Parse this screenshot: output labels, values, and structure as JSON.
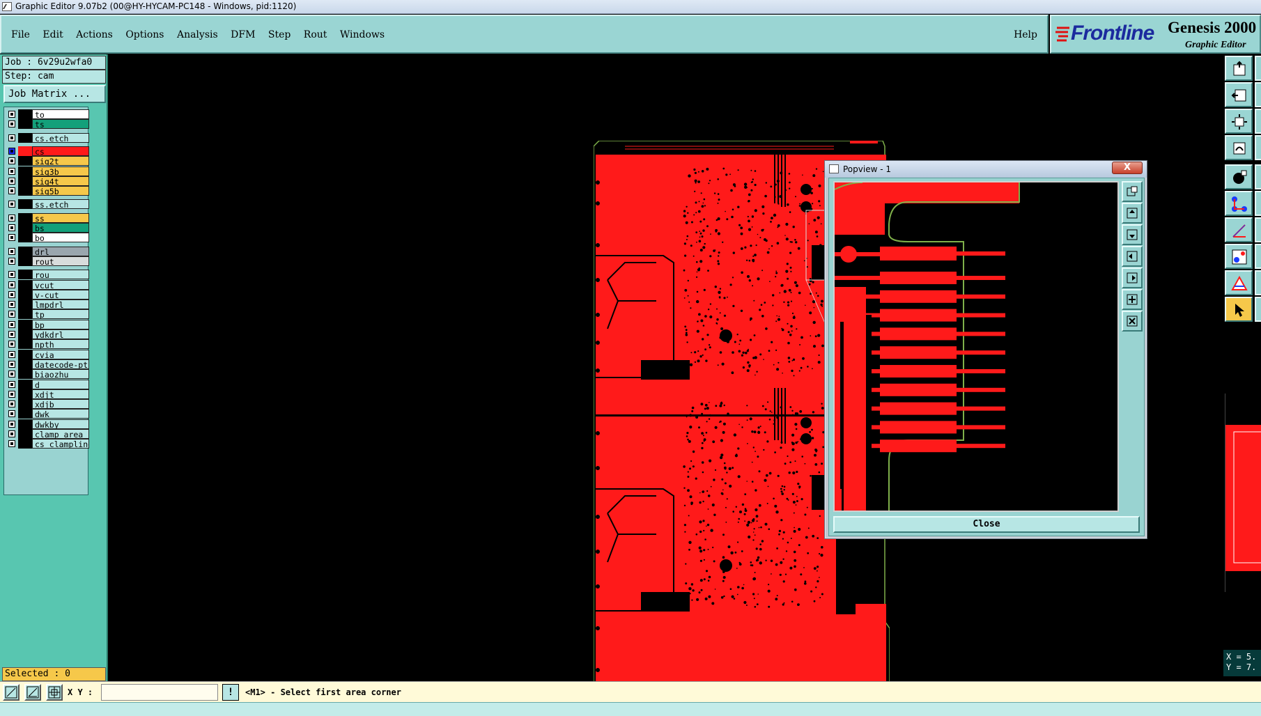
{
  "window": {
    "title": "Graphic Editor 9.07b2 (00@HY-HYCAM-PC148 - Windows, pid:1120)"
  },
  "menu": {
    "items": [
      "File",
      "Edit",
      "Actions",
      "Options",
      "Analysis",
      "DFM",
      "Step",
      "Rout",
      "Windows"
    ],
    "help": "Help"
  },
  "brand": {
    "logo": "Frontline",
    "product": "Genesis 2000",
    "subtitle": "Graphic Editor"
  },
  "job": {
    "job_label": "Job : 6v29u2wfa0",
    "step_label": "Step: cam",
    "matrix_button": "Job Matrix ..."
  },
  "layers": [
    {
      "name": "to",
      "color": "#ffffff",
      "group": 0
    },
    {
      "name": "ts",
      "color": "#13a07a",
      "group": 0
    },
    {
      "name": "cs.etch",
      "color": "#b7e6e4",
      "group": 1
    },
    {
      "name": "cs",
      "color": "#ff1a1a",
      "group": 2,
      "active": true
    },
    {
      "name": "sig2t",
      "color": "#f6c84a",
      "group": 2
    },
    {
      "name": "sig3b",
      "color": "#f6c84a",
      "group": 2
    },
    {
      "name": "sig4t",
      "color": "#f6c84a",
      "group": 2
    },
    {
      "name": "sig5b",
      "color": "#f6c84a",
      "group": 2
    },
    {
      "name": "ss.etch",
      "color": "#b7e6e4",
      "group": 3
    },
    {
      "name": "ss",
      "color": "#f6c84a",
      "group": 4
    },
    {
      "name": "bs",
      "color": "#13a07a",
      "group": 4
    },
    {
      "name": "bo",
      "color": "#ffffff",
      "group": 4
    },
    {
      "name": "drl",
      "color": "#9aa6ae",
      "group": 5
    },
    {
      "name": "rout",
      "color": "#d8dcdc",
      "group": 5
    },
    {
      "name": "rou",
      "color": "#b7e6e4",
      "group": 6
    },
    {
      "name": "vcut",
      "color": "#b7e6e4",
      "group": 6
    },
    {
      "name": "v-cut",
      "color": "#b7e6e4",
      "group": 6
    },
    {
      "name": "lmpdrl",
      "color": "#b7e6e4",
      "group": 6
    },
    {
      "name": "tp",
      "color": "#b7e6e4",
      "group": 6
    },
    {
      "name": "bp",
      "color": "#b7e6e4",
      "group": 6
    },
    {
      "name": "ydkdrl",
      "color": "#b7e6e4",
      "group": 6
    },
    {
      "name": "npth",
      "color": "#b7e6e4",
      "group": 6
    },
    {
      "name": "cvia",
      "color": "#b7e6e4",
      "group": 6
    },
    {
      "name": "datecode-pt",
      "color": "#b7e6e4",
      "group": 6
    },
    {
      "name": "biaozhu",
      "color": "#b7e6e4",
      "group": 6
    },
    {
      "name": "d",
      "color": "#b7e6e4",
      "group": 6
    },
    {
      "name": "xdjt",
      "color": "#b7e6e4",
      "group": 6
    },
    {
      "name": "xdjb",
      "color": "#b7e6e4",
      "group": 6
    },
    {
      "name": "dwk",
      "color": "#b7e6e4",
      "group": 6
    },
    {
      "name": "dwkby",
      "color": "#b7e6e4",
      "group": 6
    },
    {
      "name": "clamp_area",
      "color": "#b7e6e4",
      "group": 6
    },
    {
      "name": "cs_clampline",
      "color": "#b7e6e4",
      "group": 6
    }
  ],
  "status": {
    "selected": "Selected : 0"
  },
  "bottom": {
    "xy_label": "X Y :",
    "xy_value": "",
    "warn": "!",
    "prompt": "<M1> - Select first area corner"
  },
  "coords": {
    "x": "X = 5.",
    "y": "Y = 7."
  },
  "popview": {
    "title": "Popview - 1",
    "close_label": "Close",
    "close_x": "X"
  },
  "colors": {
    "copper": "#ff1a1a",
    "outline": "#7fb04a",
    "panel": "#9ad5d3",
    "sidebar": "#58c6b0"
  }
}
